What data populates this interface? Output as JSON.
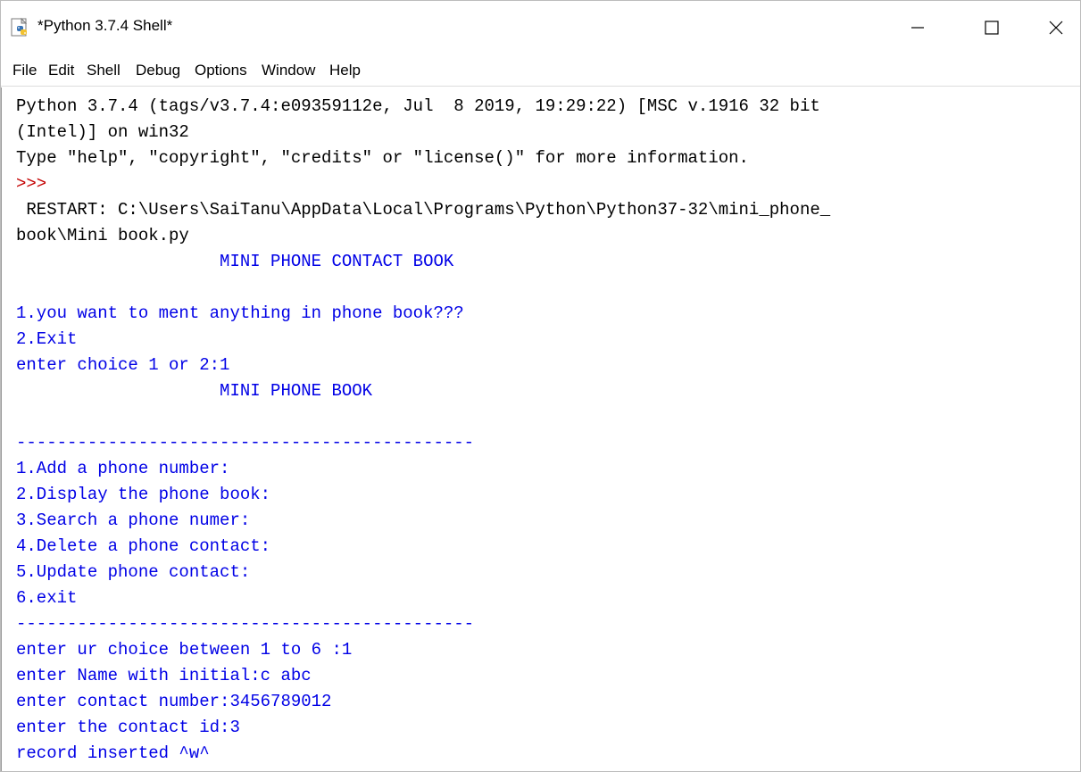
{
  "window": {
    "title": "*Python 3.7.4 Shell*",
    "app_icon": "idle-python-icon",
    "controls": [
      "minimize-icon",
      "maximize-icon",
      "close-icon"
    ]
  },
  "menu": [
    "File",
    "Edit",
    "Shell",
    "Debug",
    "Options",
    "Window",
    "Help"
  ],
  "shell": {
    "lines": [
      {
        "text": "Python 3.7.4 (tags/v3.7.4:e09359112e, Jul  8 2019, 19:29:22) [MSC v.1916 32 bit",
        "style": "out"
      },
      {
        "text": "(Intel)] on win32",
        "style": "out"
      },
      {
        "text": "Type \"help\", \"copyright\", \"credits\" or \"license()\" for more information.",
        "style": "out"
      },
      {
        "text": ">>>",
        "style": "prompt"
      },
      {
        "text": " RESTART: C:\\Users\\SaiTanu\\AppData\\Local\\Programs\\Python\\Python37-32\\mini_phone_",
        "style": "out"
      },
      {
        "text": "book\\Mini book.py",
        "style": "out"
      },
      {
        "text": "                    MINI PHONE CONTACT BOOK",
        "style": "prg"
      },
      {
        "text": "",
        "style": "prg"
      },
      {
        "text": "1.you want to ment anything in phone book???",
        "style": "prg"
      },
      {
        "text": "2.Exit",
        "style": "prg"
      },
      {
        "text": "enter choice 1 or 2:1",
        "style": "prg"
      },
      {
        "text": "                    MINI PHONE BOOK",
        "style": "prg"
      },
      {
        "text": "",
        "style": "prg"
      },
      {
        "text": "---------------------------------------------",
        "style": "prg"
      },
      {
        "text": "1.Add a phone number:",
        "style": "prg"
      },
      {
        "text": "2.Display the phone book:",
        "style": "prg"
      },
      {
        "text": "3.Search a phone numer:",
        "style": "prg"
      },
      {
        "text": "4.Delete a phone contact:",
        "style": "prg"
      },
      {
        "text": "5.Update phone contact:",
        "style": "prg"
      },
      {
        "text": "6.exit",
        "style": "prg"
      },
      {
        "text": "---------------------------------------------",
        "style": "prg"
      },
      {
        "text": "enter ur choice between 1 to 6 :1",
        "style": "prg"
      },
      {
        "text": "enter Name with initial:c abc",
        "style": "prg"
      },
      {
        "text": "enter contact number:3456789012",
        "style": "prg"
      },
      {
        "text": "enter the contact id:3",
        "style": "prg"
      },
      {
        "text": "record inserted ^w^",
        "style": "prg"
      }
    ]
  },
  "colors": {
    "stdout": "#0000e6",
    "shell_text": "#000000",
    "prompt": "#c40000"
  }
}
